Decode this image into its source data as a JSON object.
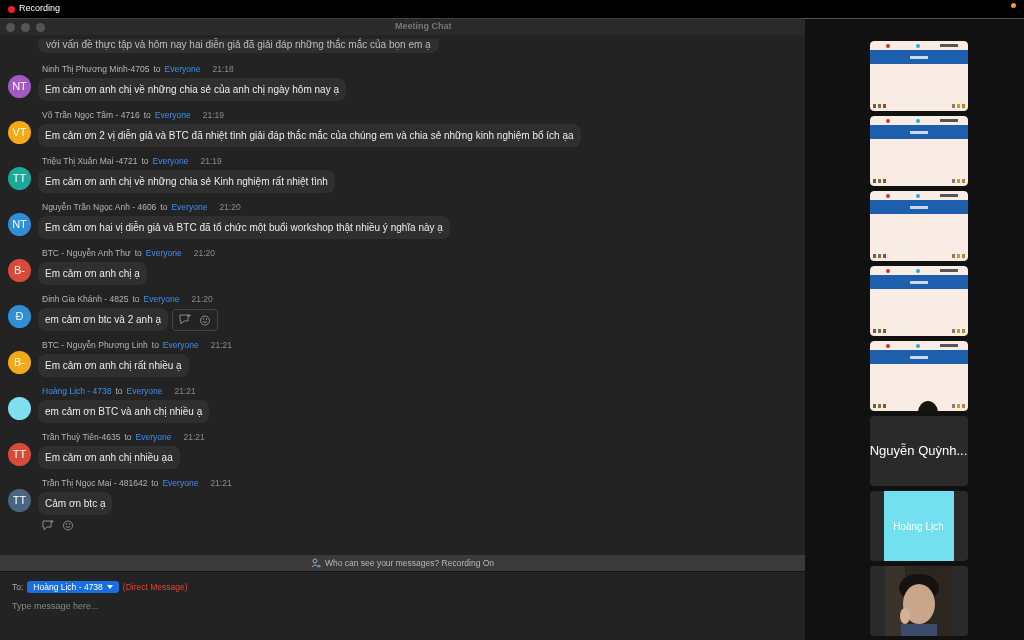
{
  "menu_bar": {
    "recording_label": "Recording"
  },
  "window": {
    "title": "Meeting Chat"
  },
  "messages": [
    {
      "kind": "continuation",
      "text": "với vấn đề thực tập và hôm nay hai diễn giả đã giải đáp những thắc mắc của bọn em ạ"
    },
    {
      "kind": "message",
      "sender": "Ninh Thị Phương Minh-4705",
      "to_word": "to",
      "to": "Everyone",
      "time": "21:18",
      "text": "Em cảm ơn anh chị về những chia sẻ của anh chị ngày hôm nay ạ",
      "avatar": {
        "initials": "NT",
        "color": "#a259c4"
      },
      "highlighted": false,
      "hovered": false
    },
    {
      "kind": "message",
      "sender": "Võ Trần Ngọc Tâm - 4716",
      "to_word": "to",
      "to": "Everyone",
      "time": "21:19",
      "text": "Em cảm ơn 2 vị diễn giả và BTC đã nhiệt tình giải đáp thắc mắc của chúng em và chia sẻ những kinh nghiệm bổ ích ạa",
      "avatar": {
        "initials": "VT",
        "color": "#f4a916"
      },
      "highlighted": false,
      "hovered": false
    },
    {
      "kind": "message",
      "sender": "Triệu Thị Xuân Mai -4721",
      "to_word": "to",
      "to": "Everyone",
      "time": "21:19",
      "text": "Em cảm ơn anh chị về những chia sẻ Kinh nghiệm rất nhiệt tình",
      "avatar": {
        "initials": "TT",
        "color": "#1aa89a"
      },
      "highlighted": false,
      "hovered": false
    },
    {
      "kind": "message",
      "sender": "Nguyễn Trần Ngọc Anh - 4606",
      "to_word": "to",
      "to": "Everyone",
      "time": "21:20",
      "text": "Em cảm ơn hai vị diễn giả và BTC đã tổ chức một buổi workshop thật nhiều ý nghĩa này ạ",
      "avatar": {
        "initials": "NT",
        "color": "#2e8fd6"
      },
      "highlighted": false,
      "hovered": false
    },
    {
      "kind": "message",
      "sender": "BTC - Nguyễn Anh Thư",
      "to_word": "to",
      "to": "Everyone",
      "time": "21:20",
      "text": "Em cảm ơn anh chị ạ",
      "avatar": {
        "initials": "B-",
        "color": "#d84a3a"
      },
      "highlighted": false,
      "hovered": false
    },
    {
      "kind": "message",
      "sender": "Đinh Gia Khánh - 4825",
      "to_word": "to",
      "to": "Everyone",
      "time": "21:20",
      "text": "em cảm ơn btc và 2 anh ạ",
      "avatar": {
        "initials": "Đ",
        "color": "#2e8fd6"
      },
      "highlighted": false,
      "hovered": true
    },
    {
      "kind": "message",
      "sender": "BTC - Nguyễn Phương Linh",
      "to_word": "to",
      "to": "Everyone",
      "time": "21:21",
      "text": "Em cảm ơn anh chị rất nhiều ạ",
      "avatar": {
        "initials": "B-",
        "color": "#f4a916"
      },
      "highlighted": false,
      "hovered": false
    },
    {
      "kind": "message",
      "sender": "Hoàng Lịch - 4738",
      "to_word": "to",
      "to": "Everyone",
      "time": "21:21",
      "text": "em cảm ơn BTC và anh chị nhiều ạ",
      "avatar": {
        "color": "#7fdfee"
      },
      "highlighted": true,
      "hovered": false
    },
    {
      "kind": "message",
      "sender": "Trần Thuỳ Tiên-4635",
      "to_word": "to",
      "to": "Everyone",
      "time": "21:21",
      "text": "Em cảm ơn anh chị nhiều ạa",
      "avatar": {
        "initials": "TT",
        "color": "#d84a3a"
      },
      "highlighted": false,
      "hovered": false
    },
    {
      "kind": "message",
      "sender": "Trần Thị Ngọc Mai - 481642",
      "to_word": "to",
      "to": "Everyone",
      "time": "21:21",
      "text": "Cảm ơn btc ạ",
      "avatar": {
        "initials": "TT",
        "color": "#4a6580"
      },
      "highlighted": false,
      "hovered": false,
      "footer_actions": true
    }
  ],
  "notice": {
    "text": "Who can see your messages? Recording On"
  },
  "compose": {
    "to_label": "To:",
    "recipient": "Hoàng Lịch - 4738",
    "recipient_note": "(Direct Message)",
    "placeholder": "Type message here..."
  },
  "video_tiles": [
    {
      "kind": "slide"
    },
    {
      "kind": "slide"
    },
    {
      "kind": "slide"
    },
    {
      "kind": "slide"
    },
    {
      "kind": "slide_person"
    },
    {
      "kind": "name",
      "name": "Nguyễn Quỳnh..."
    },
    {
      "kind": "avatar",
      "name": "Hoàng Lịch",
      "color": "#72e0ee"
    },
    {
      "kind": "camera"
    }
  ]
}
